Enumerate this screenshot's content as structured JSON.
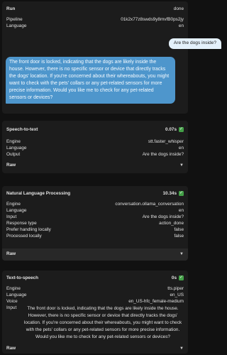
{
  "run": {
    "title": "Run",
    "status": "done",
    "rows": [
      {
        "key": "Pipeline",
        "value": "01k2x77z8swds9y8mvfB0ps2jy"
      },
      {
        "key": "Language",
        "value": "en"
      }
    ],
    "user_message": "Are the dogs inside?",
    "assistant_message": "The front door is locked, indicating that the dogs are likely inside the house. However, there is no specific sensor or device that directly tracks the dogs' location. If you're concerned about their whereabouts, you might want to check with the pets' collars or any pet-related sensors for more precise information. Would you like me to check for any pet-related sensors or devices?"
  },
  "stt": {
    "title": "Speech-to-text",
    "time": "0.07s",
    "rows": [
      {
        "key": "Engine",
        "value": "stt.faster_whisper"
      },
      {
        "key": "Language",
        "value": "en"
      },
      {
        "key": "Output",
        "value": "Are the dogs inside?"
      }
    ],
    "raw_label": "Raw"
  },
  "nlp": {
    "title": "Natural Language Processing",
    "time": "10.34s",
    "rows": [
      {
        "key": "Engine",
        "value": "conversation.ollama_conversation"
      },
      {
        "key": "Language",
        "value": "en"
      },
      {
        "key": "Input",
        "value": "Are the dogs inside?"
      },
      {
        "key": "Response type",
        "value": "action_done"
      },
      {
        "key": "Prefer handling locally",
        "value": "false"
      },
      {
        "key": "Processed locally",
        "value": "false"
      }
    ],
    "raw_label": "Raw"
  },
  "tts": {
    "title": "Text-to-speech",
    "time": "0s",
    "rows": [
      {
        "key": "Engine",
        "value": "tts.piper"
      },
      {
        "key": "Language",
        "value": "en_US"
      },
      {
        "key": "Voice",
        "value": "en_US-hfc_female-medium"
      }
    ],
    "input_key": "Input",
    "input_value": "The front door is locked, indicating that the dogs are likely inside the house. However, there is no specific sensor or device that directly tracks the dogs' location. If you're concerned about their whereabouts, you might want to check with the pets' collars or any pet-related sensors for more precise information. Would you like me to check for any pet-related sensors or devices?",
    "raw_label": "Raw"
  },
  "icons": {
    "check": "check-icon",
    "chevron": "chevron-down-icon"
  },
  "colors": {
    "background": "#111111",
    "card": "#1c1c1c",
    "assistant_bubble": "#4e96cc",
    "user_bubble": "#e3f0fb",
    "success": "#43a047"
  }
}
